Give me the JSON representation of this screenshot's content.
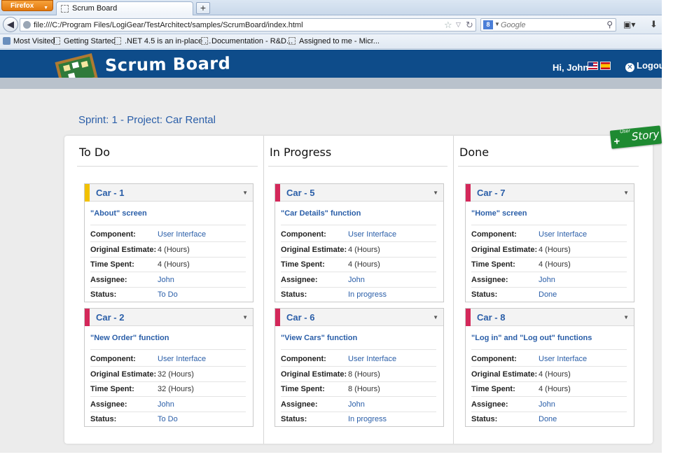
{
  "browser": {
    "menu_label": "Firefox",
    "tab_title": "Scrum Board",
    "new_tab": "+",
    "url": "file:///C:/Program Files/LogiGear/TestArchitect/samples/ScrumBoard/index.html",
    "search_placeholder": "Google",
    "search_engine_letter": "8",
    "bookmarks": [
      "Most Visited",
      "Getting Started",
      ".NET 4.5 is an in-place ...",
      "Documentation - R&D...",
      "Assigned to me - Micr..."
    ]
  },
  "app": {
    "title": "Scrum Board",
    "greeting": "Hi, John",
    "logout_label": "Logout",
    "add_story_label": "Story",
    "add_story_small": "User",
    "sprint_title": "Sprint: 1 - Project: Car Rental"
  },
  "field_labels": {
    "component": "Component:",
    "estimate": "Original Estimate:",
    "spent": "Time Spent:",
    "assignee": "Assignee:",
    "status": "Status:"
  },
  "columns": [
    {
      "title": "To Do",
      "cards": [
        {
          "id": "Car - 1",
          "name": "\"About\" screen",
          "component": "User Interface",
          "estimate": "4 (Hours)",
          "spent": "4 (Hours)",
          "assignee": "John",
          "status": "To Do",
          "color": "#f2c100"
        },
        {
          "id": "Car - 2",
          "name": "\"New Order\" function",
          "component": "User Interface",
          "estimate": "32 (Hours)",
          "spent": "32 (Hours)",
          "assignee": "John",
          "status": "To Do",
          "color": "#d4285a"
        }
      ]
    },
    {
      "title": "In Progress",
      "cards": [
        {
          "id": "Car - 5",
          "name": "\"Car Details\" function",
          "component": "User Interface",
          "estimate": "4 (Hours)",
          "spent": "4 (Hours)",
          "assignee": "John",
          "status": "In progress",
          "color": "#d4285a"
        },
        {
          "id": "Car - 6",
          "name": "\"View Cars\" function",
          "component": "User Interface",
          "estimate": "8 (Hours)",
          "spent": "8 (Hours)",
          "assignee": "John",
          "status": "In progress",
          "color": "#d4285a"
        }
      ]
    },
    {
      "title": "Done",
      "cards": [
        {
          "id": "Car - 7",
          "name": "\"Home\" screen",
          "component": "User Interface",
          "estimate": "4 (Hours)",
          "spent": "4 (Hours)",
          "assignee": "John",
          "status": "Done",
          "color": "#d4285a"
        },
        {
          "id": "Car - 8",
          "name": "\"Log in\" and \"Log out\" functions",
          "component": "User Interface",
          "estimate": "4 (Hours)",
          "spent": "4 (Hours)",
          "assignee": "John",
          "status": "Done",
          "color": "#d4285a"
        }
      ]
    }
  ],
  "colors": {
    "header_bg": "#0e4c8a",
    "link_blue": "#2a5ea8",
    "add_story_green": "#1e8a31"
  }
}
